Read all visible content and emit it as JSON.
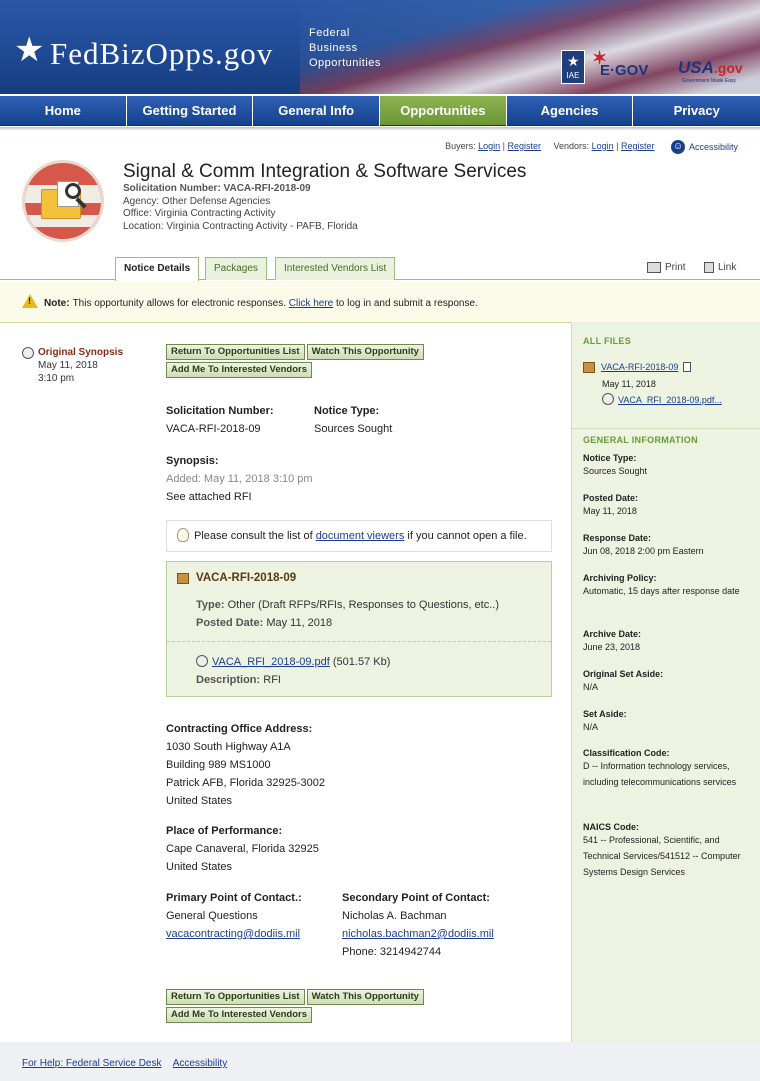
{
  "header": {
    "logo_text": "FedBizOpps.gov",
    "subtitle_lines": [
      "Federal",
      "Business",
      "Opportunities"
    ],
    "iae_label": "IAE",
    "egov_label": "E·GOV",
    "usagov_label": "USA",
    "usagov_suffix": ".gov",
    "usagov_tagline": "Government Made Easy"
  },
  "nav": {
    "items": [
      "Home",
      "Getting Started",
      "General Info",
      "Opportunities",
      "Agencies",
      "Privacy"
    ],
    "active": "Opportunities"
  },
  "userlinks": {
    "buyers_label": "Buyers:",
    "buyers_login": "Login",
    "buyers_register": "Register",
    "vendors_label": "Vendors:",
    "vendors_login": "Login",
    "vendors_register": "Register",
    "accessibility": "Accessibility"
  },
  "opportunity": {
    "title": "Signal & Comm Integration & Software Services",
    "solicitation_line": "Solicitation Number: VACA-RFI-2018-09",
    "agency_line": "Agency: Other Defense Agencies",
    "office_line": "Office: Virginia Contracting Activity",
    "location_line": "Location: Virginia Contracting Activity - PAFB, Florida"
  },
  "tabs": [
    "Notice Details",
    "Packages",
    "Interested Vendors List"
  ],
  "tools": {
    "print": "Print",
    "link": "Link"
  },
  "notice": {
    "label": "Note:",
    "text": "This opportunity allows for electronic responses.",
    "link": "Click here",
    "text_after": "to log in and submit a response."
  },
  "side": {
    "label": "Original Synopsis",
    "date": "May 11, 2018",
    "time": "3:10 pm"
  },
  "buttons": {
    "return": "Return To Opportunities List",
    "watch": "Watch This Opportunity",
    "add": "Add Me To Interested Vendors"
  },
  "details": {
    "sol_label": "Solicitation Number:",
    "sol_value": "VACA-RFI-2018-09",
    "type_label": "Notice Type:",
    "type_value": "Sources Sought",
    "synopsis_label": "Synopsis:",
    "synopsis_added": "Added: May 11, 2018 3:10 pm",
    "synopsis_text": "See attached RFI"
  },
  "tip": {
    "before": "Please consult the list of",
    "link": "document viewers",
    "after": "if you cannot open a file."
  },
  "file": {
    "name": "VACA-RFI-2018-09",
    "type_label": "Type:",
    "type_value": "Other (Draft RFPs/RFIs, Responses to Questions, etc..)",
    "posted_label": "Posted Date:",
    "posted_value": "May 11, 2018",
    "pdf_name": "VACA_RFI_2018-09.pdf",
    "pdf_size": "(501.57 Kb)",
    "desc_label": "Description:",
    "desc_value": "RFI"
  },
  "address": {
    "label": "Contracting Office Address:",
    "lines": [
      "1030 South Highway A1A",
      "Building 989 MS1000",
      "Patrick AFB, Florida 32925-3002",
      "United States"
    ]
  },
  "performance": {
    "label": "Place of Performance:",
    "lines": [
      "Cape Canaveral, Florida 32925",
      "United States"
    ]
  },
  "contacts": {
    "primary_label": "Primary Point of Contact.:",
    "primary_name": "General Questions",
    "primary_email": "vacacontracting@dodiis.mil",
    "secondary_label": "Secondary Point of Contact:",
    "secondary_name": "Nicholas A. Bachman",
    "secondary_email": "nicholas.bachman2@dodiis.mil",
    "secondary_phone": "Phone: 3214942744"
  },
  "sidebar": {
    "all_files": "ALL FILES",
    "file_name": "VACA-RFI-2018-09",
    "file_date": "May 11, 2018",
    "file_pdf": "VACA_RFI_2018-09.pdf...",
    "general_info": "GENERAL INFORMATION",
    "fields": [
      {
        "k": "Notice Type:",
        "v": "Sources Sought"
      },
      {
        "k": "Posted Date:",
        "v": "May 11, 2018"
      },
      {
        "k": "Response Date:",
        "v": "Jun 08, 2018 2:00 pm Eastern"
      },
      {
        "k": "Archiving Policy:",
        "v": "Automatic, 15 days after response date"
      },
      {
        "k": "Archive Date:",
        "v": "June 23, 2018"
      },
      {
        "k": "Original Set Aside:",
        "v": "N/A"
      },
      {
        "k": "Set Aside:",
        "v": "N/A"
      },
      {
        "k": "Classification Code:",
        "v": "D -- Information technology services, including telecommunications services"
      },
      {
        "k": "NAICS Code:",
        "v": "541 -- Professional, Scientific, and Technical Services/541512 -- Computer Systems Design Services"
      }
    ]
  },
  "footer": {
    "help": "For Help: Federal Service Desk",
    "accessibility": "Accessibility"
  },
  "colors": {
    "nav_blue": "#1f4a95",
    "nav_active": "#7ba542",
    "sidebar_bg": "#ecf3e1",
    "link": "#1b3f8f"
  }
}
